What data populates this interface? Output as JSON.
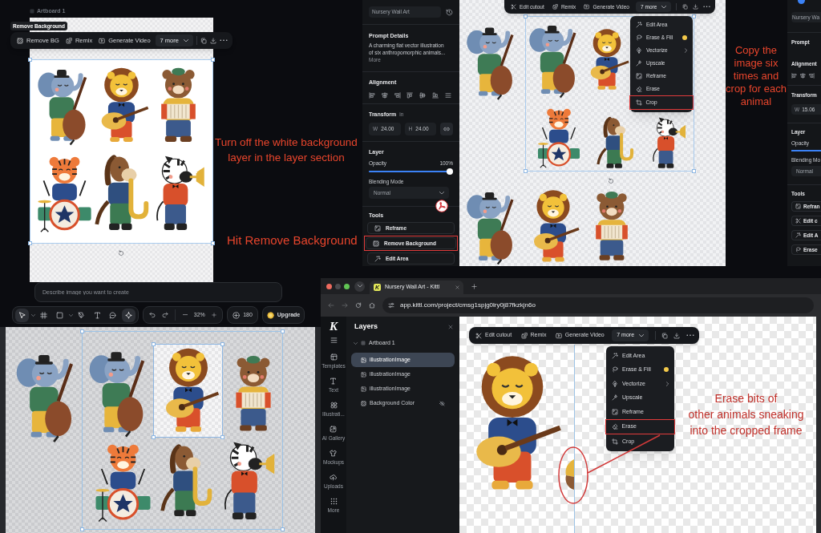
{
  "annotations": [
    {
      "text": "Turn off the white background\nlayer in the layer section"
    },
    {
      "text": "Hit Remove Background"
    },
    {
      "text": "Copy the image six times and crop for each animal"
    },
    {
      "text": "Erase bits of\nother animals sneaking\ninto the cropped frame"
    }
  ],
  "artboard_view": {
    "artboard_label": "Artboard 1",
    "tooltip": "Remove Background",
    "toolbar": {
      "actions": [
        {
          "kind": "remove_bg",
          "label": "Remove BG"
        },
        {
          "kind": "remix",
          "label": "Remix"
        },
        {
          "kind": "video",
          "label": "Generate Video"
        }
      ],
      "more": "7 more"
    }
  },
  "editor": {
    "sidebar": {
      "project_name": "Nursery Wall Art",
      "prompt_title": "Prompt Details",
      "prompt_text": "A charming flat vector illustration of six anthropomorphic animals...",
      "more_link": "More",
      "alignment_title": "Alignment",
      "transform_title": "Transform",
      "transform_unit": "in",
      "fields": [
        {
          "label": "W",
          "value": "24.00"
        },
        {
          "label": "H",
          "value": "24.00"
        }
      ],
      "layer_title": "Layer",
      "opacity": {
        "label": "Opacity",
        "reading": "100%",
        "level": 1
      },
      "blend": {
        "label": "Blending Mode",
        "value": "Normal"
      },
      "tools_title": "Tools",
      "tools": [
        {
          "kind": "reframe",
          "label": "Reframe",
          "highlighted": false
        },
        {
          "kind": "remove_bg",
          "label": "Remove Background",
          "highlighted": true
        },
        {
          "kind": "edit_area",
          "label": "Edit Area",
          "highlighted": false
        }
      ]
    },
    "toolbar": {
      "actions": [
        {
          "kind": "edit_cutout",
          "label": "Edit cutout"
        },
        {
          "kind": "remix",
          "label": "Remix"
        },
        {
          "kind": "video",
          "label": "Generate Video"
        }
      ],
      "more": "7 more"
    },
    "menu": [
      {
        "kind": "edit_area",
        "label": "Edit Area",
        "premium": false,
        "submenu": false,
        "highlighted": false
      },
      {
        "kind": "erase_fill",
        "label": "Erase & Fill",
        "premium": true,
        "submenu": false,
        "highlighted": false
      },
      {
        "kind": "vectorize",
        "label": "Vectorize",
        "premium": false,
        "submenu": true,
        "highlighted": false
      },
      {
        "kind": "upscale",
        "label": "Upscale",
        "premium": false,
        "submenu": false,
        "highlighted": false
      },
      {
        "kind": "reframe",
        "label": "Reframe",
        "premium": false,
        "submenu": false,
        "highlighted": false
      },
      {
        "kind": "erase",
        "label": "Erase",
        "premium": false,
        "submenu": false,
        "highlighted": false
      },
      {
        "kind": "crop",
        "label": "Crop",
        "premium": false,
        "submenu": false,
        "highlighted": true
      }
    ]
  },
  "clipped_panel": {
    "project_name": "Nursery Wa",
    "prompt_title": "Prompt",
    "alignment_title": "Alignment",
    "transform_title": "Transform",
    "fields": [
      {
        "label": "W",
        "value": "15.06"
      }
    ],
    "layer_title": "Layer",
    "opacity": {
      "label": "Opacity",
      "level": 1
    },
    "blend": {
      "label": "Blending Mo",
      "value": "Normal"
    },
    "tools_title": "Tools",
    "tools": [
      {
        "kind": "reframe",
        "label": "Refran"
      },
      {
        "kind": "edit_cutout",
        "label": "Edit c"
      },
      {
        "kind": "edit_area",
        "label": "Edit A"
      },
      {
        "kind": "erase_fill",
        "label": "Erase"
      }
    ]
  },
  "composer": {
    "placeholder": "Describe image you want to create",
    "tools": [
      {
        "kind": "select",
        "selected": true,
        "dropdown": true
      },
      {
        "kind": "frame",
        "selected": false,
        "dropdown": false
      },
      {
        "kind": "shape",
        "selected": false,
        "dropdown": true
      },
      {
        "kind": "pen",
        "selected": false,
        "dropdown": false
      },
      {
        "kind": "text",
        "selected": false,
        "dropdown": false
      },
      {
        "kind": "comment",
        "selected": false,
        "dropdown": false
      },
      {
        "kind": "ai",
        "selected": true,
        "dropdown": false
      }
    ],
    "zoom": "32%",
    "credits": "180",
    "upgrade": "Upgrade"
  },
  "browser": {
    "tab": {
      "favicon": "K",
      "title": "Nursery Wall Art - Kittl"
    },
    "url": "app.kittl.com/project/cmsg1spjg0lry0j87fkzkjn6o",
    "logo": "K",
    "rail": [
      {
        "kind": "templates",
        "label": "Templates"
      },
      {
        "kind": "text",
        "label": "Text"
      },
      {
        "kind": "illustrations",
        "label": "Illustrati..."
      },
      {
        "kind": "ai_gallery",
        "label": "AI Gallery"
      },
      {
        "kind": "mockups",
        "label": "Mockups"
      },
      {
        "kind": "uploads",
        "label": "Uploads"
      },
      {
        "kind": "more",
        "label": "More"
      }
    ],
    "layers": {
      "title": "Layers",
      "artboard": {
        "label": "Artboard 1",
        "expanded": true,
        "children": [
          {
            "kind": "image",
            "label": "illustrationImage",
            "selected": true,
            "hidden": false
          },
          {
            "kind": "image",
            "label": "illustrationImage",
            "selected": false,
            "hidden": false
          },
          {
            "kind": "image",
            "label": "illustrationImage",
            "selected": false,
            "hidden": false
          },
          {
            "kind": "background",
            "label": "Background Color",
            "selected": false,
            "hidden": true
          }
        ]
      }
    },
    "toolbar": {
      "actions": [
        {
          "kind": "edit_cutout",
          "label": "Edit cutout"
        },
        {
          "kind": "remix",
          "label": "Remix"
        },
        {
          "kind": "video",
          "label": "Generate Video"
        }
      ],
      "more": "7 more"
    },
    "menu": [
      {
        "kind": "edit_area",
        "label": "Edit Area",
        "premium": false,
        "submenu": false,
        "highlighted": false
      },
      {
        "kind": "erase_fill",
        "label": "Erase & Fill",
        "premium": true,
        "submenu": false,
        "highlighted": false
      },
      {
        "kind": "vectorize",
        "label": "Vectorize",
        "premium": false,
        "submenu": true,
        "highlighted": false
      },
      {
        "kind": "upscale",
        "label": "Upscale",
        "premium": false,
        "submenu": false,
        "highlighted": false
      },
      {
        "kind": "reframe",
        "label": "Reframe",
        "premium": false,
        "submenu": false,
        "highlighted": false
      },
      {
        "kind": "erase",
        "label": "Erase",
        "premium": false,
        "submenu": false,
        "highlighted": true
      },
      {
        "kind": "crop",
        "label": "Crop",
        "premium": false,
        "submenu": false,
        "highlighted": false
      }
    ]
  }
}
